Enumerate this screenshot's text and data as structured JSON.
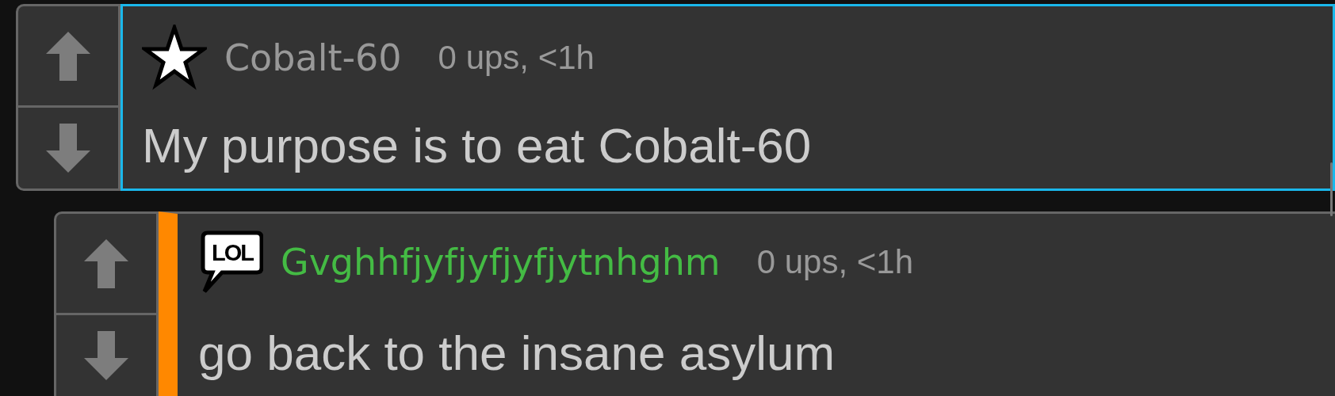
{
  "comments": [
    {
      "flair": {
        "kind": "star"
      },
      "username": "Cobalt-60",
      "color": "#999999",
      "meta": "0 ups, <1h",
      "body": "My purpose is to eat Cobalt-60",
      "highlighted": true,
      "reply": false
    },
    {
      "flair": {
        "kind": "speech",
        "text": "LOL"
      },
      "username": "Gvghhfjyfjyfjyfjytnhghm",
      "color": "#44bb44",
      "meta": "0 ups, <1h",
      "body": "go back to the insane asylum",
      "highlighted": false,
      "reply": true
    }
  ]
}
